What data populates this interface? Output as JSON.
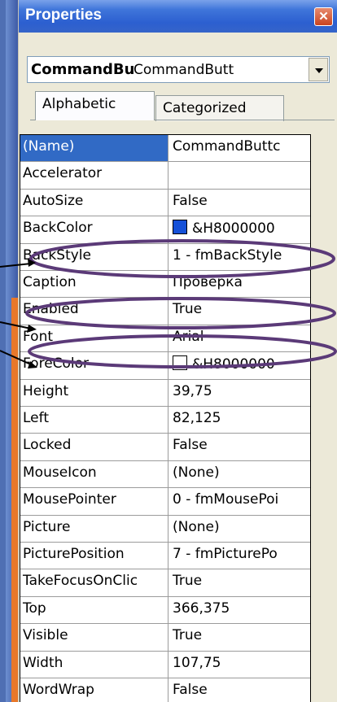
{
  "window": {
    "title": "Properties",
    "close_icon": "close-icon"
  },
  "object_selector": {
    "name": "CommandBu",
    "type": "CommandButt"
  },
  "tabs": [
    {
      "label": "Alphabetic",
      "active": true
    },
    {
      "label": "Categorized",
      "active": false
    }
  ],
  "properties": [
    {
      "name": "(Name)",
      "value": "CommandButtc",
      "selected": true
    },
    {
      "name": "Accelerator",
      "value": ""
    },
    {
      "name": "AutoSize",
      "value": "False"
    },
    {
      "name": "BackColor",
      "value": "&H8000000",
      "swatch": "#1550d8"
    },
    {
      "name": "BackStyle",
      "value": "1 - fmBackStyle"
    },
    {
      "name": "Caption",
      "value": "Проверка"
    },
    {
      "name": "Enabled",
      "value": "True"
    },
    {
      "name": "Font",
      "value": "Arial"
    },
    {
      "name": "ForeColor",
      "value": "&H8000000",
      "swatch": "#ffffff"
    },
    {
      "name": "Height",
      "value": "39,75"
    },
    {
      "name": "Left",
      "value": "82,125"
    },
    {
      "name": "Locked",
      "value": "False"
    },
    {
      "name": "MouseIcon",
      "value": "(None)"
    },
    {
      "name": "MousePointer",
      "value": "0 - fmMousePoi"
    },
    {
      "name": "Picture",
      "value": "(None)"
    },
    {
      "name": "PicturePosition",
      "value": "7 - fmPicturePo"
    },
    {
      "name": "TakeFocusOnClic",
      "value": "True"
    },
    {
      "name": "Top",
      "value": "366,375"
    },
    {
      "name": "Visible",
      "value": "True"
    },
    {
      "name": "Width",
      "value": "107,75"
    },
    {
      "name": "WordWrap",
      "value": "False"
    }
  ],
  "colors": {
    "annotation_ellipse": "#5b3a78",
    "selection": "#316ac5",
    "titlebar": "#2c5fd0"
  }
}
